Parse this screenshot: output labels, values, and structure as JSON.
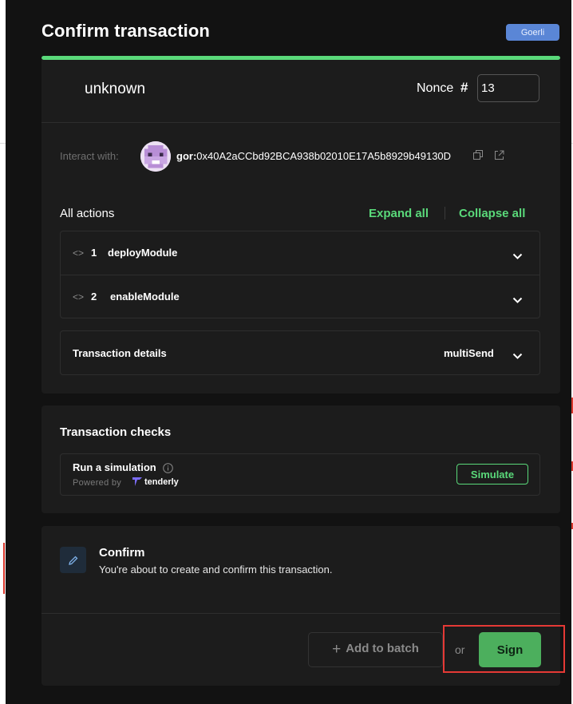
{
  "modal": {
    "title": "Confirm transaction",
    "network_chip": "Goerli",
    "progress_fraction": 1.0
  },
  "summary": {
    "method_name": "unknown",
    "nonce_label": "Nonce",
    "nonce_hash": "#",
    "nonce_value": "13"
  },
  "interact": {
    "label": "Interact with:",
    "prefix": "gor:",
    "address": "0x40A2aCCbd92BCA938b02010E17A5b8929b49130D"
  },
  "actions": {
    "title": "All actions",
    "expand_all": "Expand all",
    "collapse_all": "Collapse all",
    "items": [
      {
        "number": "1",
        "name": "deployModule"
      },
      {
        "number": "2",
        "name": "enableModule"
      }
    ]
  },
  "details": {
    "label": "Transaction details",
    "value": "multiSend"
  },
  "checks": {
    "title": "Transaction checks",
    "simulation_title": "Run a simulation",
    "powered_by": "Powered by",
    "provider": "tenderly",
    "simulate_button": "Simulate"
  },
  "confirm": {
    "title": "Confirm",
    "subtitle": "You're about to create and confirm this transaction.",
    "add_to_batch": "Add to batch",
    "or": "or",
    "sign_button": "Sign"
  },
  "colors": {
    "accent": "#5ad97a",
    "modal_bg": "#121212",
    "card_bg": "#1c1c1c",
    "chip_bg": "#5a86d6",
    "sign_bg": "#4caf5d",
    "highlight": "#e53935"
  },
  "icons": [
    "copy-icon",
    "external-link-icon",
    "code-icon",
    "chevron-down-icon",
    "info-icon",
    "tenderly-logo-icon",
    "pencil-icon",
    "plus-icon"
  ]
}
